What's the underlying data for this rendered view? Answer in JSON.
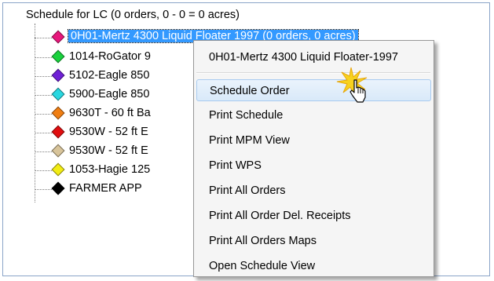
{
  "tree": {
    "root_label": "Schedule for LC  (0 orders, 0 - 0 = 0 acres)",
    "items": [
      {
        "label": "0H01-Mertz 4300 Liquid Floater 1997 (0 orders, 0 acres)",
        "color": "#e8177c",
        "selected": true
      },
      {
        "label": "1014-RoGator 9",
        "color": "#19d13d"
      },
      {
        "label": "5102-Eagle 850",
        "color": "#6f1fd6"
      },
      {
        "label": "5900-Eagle 850",
        "color": "#29d7e0"
      },
      {
        "label": "9630T - 60 ft Ba",
        "color": "#f07e12"
      },
      {
        "label": "9530W - 52 ft E",
        "color": "#e10e10"
      },
      {
        "label": "9530W - 52 ft E",
        "color": "#d8c49a"
      },
      {
        "label": "1053-Hagie 125",
        "color": "#f2ec14"
      },
      {
        "label": "FARMER APP",
        "color": "#000000"
      }
    ]
  },
  "context_menu": {
    "title": "0H01-Mertz 4300 Liquid Floater-1997",
    "items": [
      {
        "label": "Schedule Order",
        "hover": true
      },
      {
        "label": "Print Schedule"
      },
      {
        "label": "Print MPM View"
      },
      {
        "label": "Print WPS"
      },
      {
        "label": "Print All Orders"
      },
      {
        "label": "Print All Order Del. Receipts"
      },
      {
        "label": "Print All Orders Maps"
      },
      {
        "label": "Open Schedule View"
      }
    ]
  },
  "cursor": {
    "icon": "hand-pointer-icon",
    "burst_color": "#f7d21f"
  }
}
